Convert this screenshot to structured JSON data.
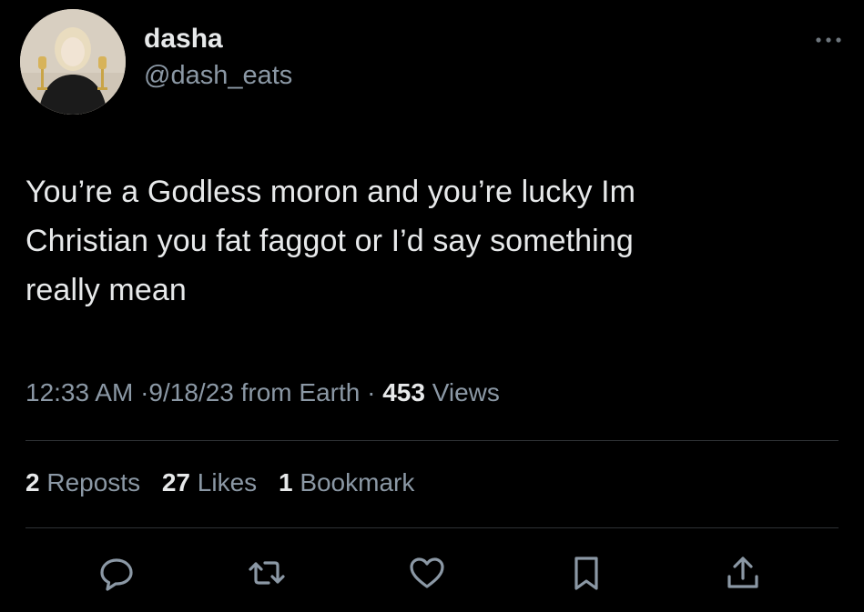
{
  "tweet": {
    "author": {
      "display_name": "dasha",
      "handle": "@dash_eats",
      "avatar": "avatar-photo"
    },
    "more_icon": "more-dots-icon",
    "text_lines": [
      "You’re a Godless moron and you’re lucky Im",
      "Christian you fat faggot or I’d say something",
      "really mean"
    ],
    "meta": {
      "time": "12:33 AM",
      "separator": "·",
      "date": "9/18/23",
      "source": "from Earth",
      "views_count": "453",
      "views_label": "Views"
    },
    "stats": {
      "reposts_count": "2",
      "reposts_label": "Reposts",
      "likes_count": "27",
      "likes_label": "Likes",
      "bookmarks_count": "1",
      "bookmarks_label": "Bookmark"
    },
    "actions": [
      {
        "name": "reply",
        "icon": "reply-icon"
      },
      {
        "name": "repost",
        "icon": "repost-icon"
      },
      {
        "name": "like",
        "icon": "heart-icon"
      },
      {
        "name": "bookmark",
        "icon": "bookmark-icon"
      },
      {
        "name": "share",
        "icon": "share-icon"
      }
    ],
    "colors": {
      "background": "#000000",
      "primary_text": "#e7e9ea",
      "secondary_text": "#8b98a5",
      "divider": "#2f3336"
    }
  }
}
